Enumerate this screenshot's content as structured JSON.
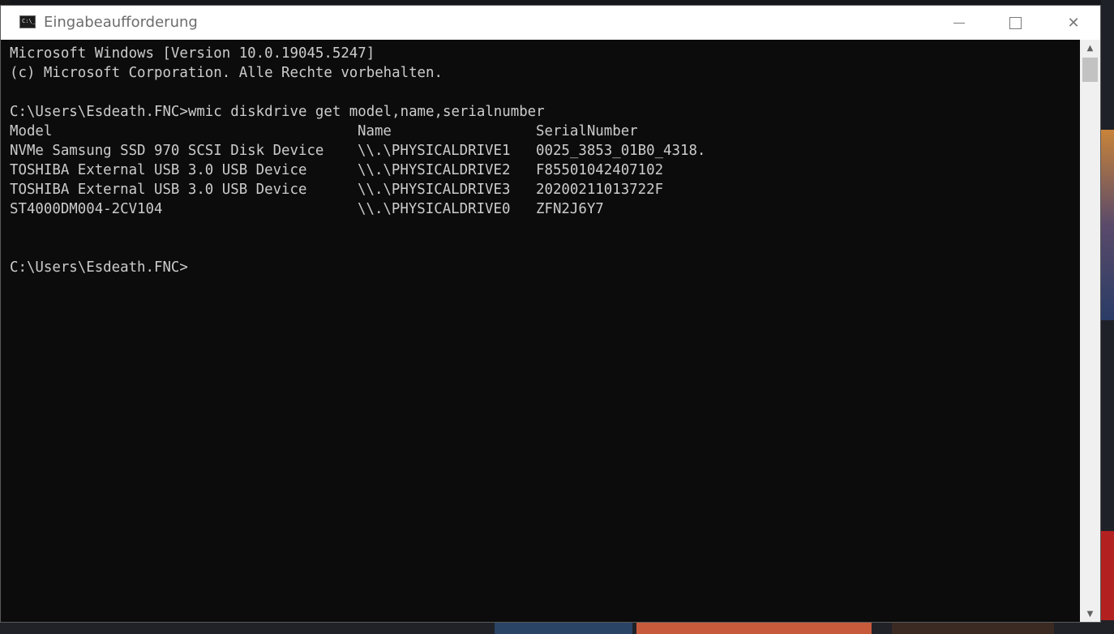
{
  "window": {
    "title": "Eingabeaufforderung",
    "icon_label": "C:\\_"
  },
  "console": {
    "header_lines": [
      "Microsoft Windows [Version 10.0.19045.5247]",
      "(c) Microsoft Corporation. Alle Rechte vorbehalten."
    ],
    "command": "C:\\Users\\Esdeath.FNC>wmic diskdrive get model,name,serialnumber",
    "table": {
      "headers": [
        "Model",
        "Name",
        "SerialNumber"
      ],
      "rows": [
        [
          "NVMe Samsung SSD 970 SCSI Disk Device",
          "\\\\.\\PHYSICALDRIVE1",
          "0025_3853_01B0_4318."
        ],
        [
          "TOSHIBA External USB 3.0 USB Device",
          "\\\\.\\PHYSICALDRIVE2",
          "F85501042407102"
        ],
        [
          "TOSHIBA External USB 3.0 USB Device",
          "\\\\.\\PHYSICALDRIVE3",
          "20200211013722F"
        ],
        [
          "ST4000DM004-2CV104",
          "\\\\.\\PHYSICALDRIVE0",
          "ZFN2J6Y7"
        ]
      ]
    },
    "prompt": "C:\\Users\\Esdeath.FNC>"
  },
  "controls": {
    "close_glyph": "✕",
    "scroll_up_glyph": "▲",
    "scroll_down_glyph": "▼"
  },
  "colors": {
    "console_bg": "#0c0c0c",
    "console_text": "#cccccc",
    "titlebar_bg": "#ffffff"
  }
}
